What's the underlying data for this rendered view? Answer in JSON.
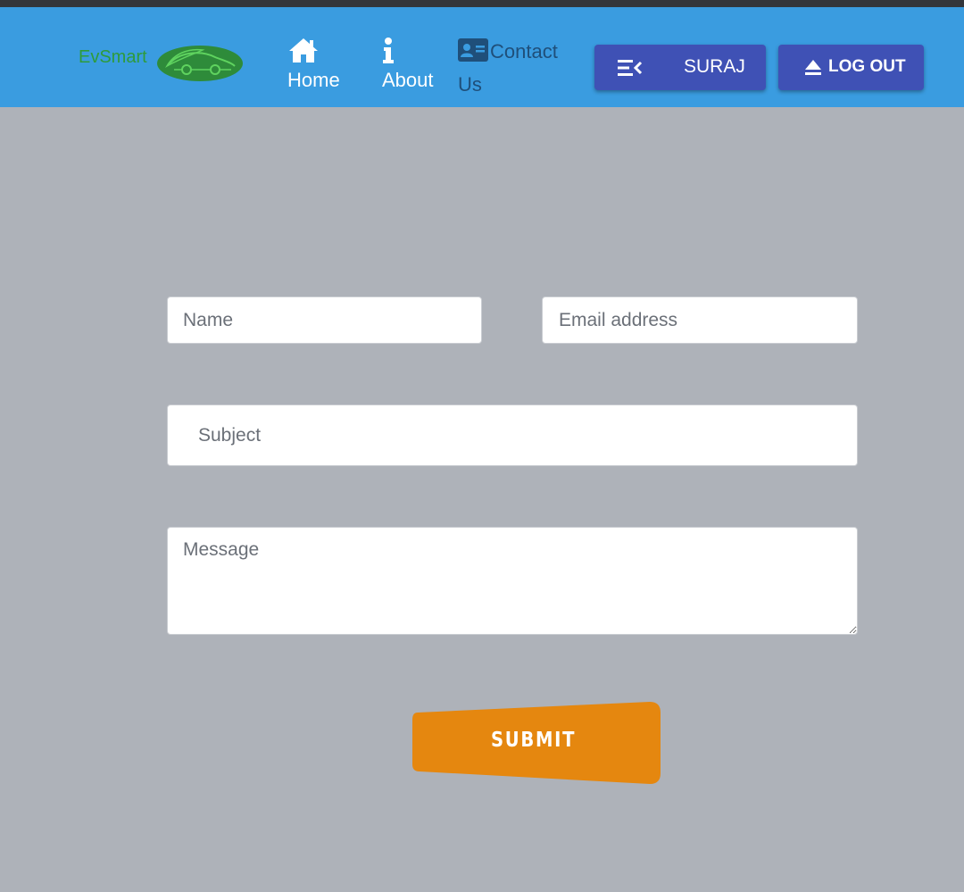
{
  "brand": {
    "name": "EvSmart",
    "logo_color": "#2e9b3b"
  },
  "nav": {
    "home": {
      "label": "Home",
      "icon": "home-icon"
    },
    "about": {
      "label": "About",
      "icon": "info-icon"
    },
    "contact": {
      "label": "Contact Us",
      "icon": "contact-card-icon"
    }
  },
  "user": {
    "name": "SURAJ",
    "icon": "menu-collapse-icon"
  },
  "logout": {
    "label": "LOG OUT",
    "icon": "eject-icon"
  },
  "form": {
    "name_placeholder": "Name",
    "email_placeholder": "Email address",
    "subject_placeholder": "Subject",
    "message_placeholder": "Message",
    "submit_label": "SUBMIT"
  },
  "colors": {
    "navbar": "#3a9ce0",
    "button": "#3f51b5",
    "submit": "#e5870f",
    "background": "#aeb2b9"
  }
}
